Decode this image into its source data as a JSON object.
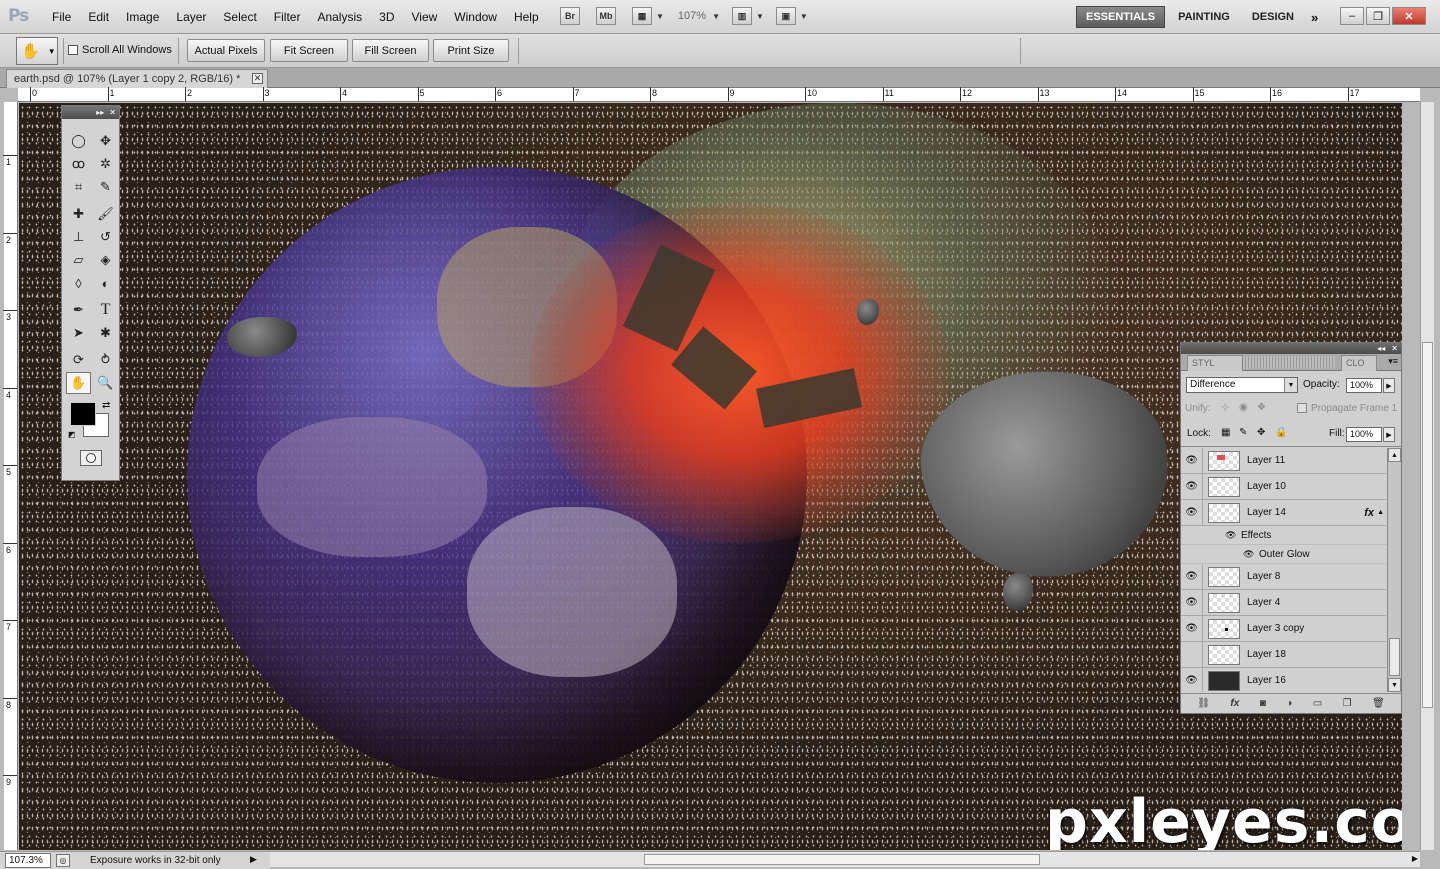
{
  "app": {
    "logo": "Ps"
  },
  "menu": [
    "File",
    "Edit",
    "Image",
    "Layer",
    "Select",
    "Filter",
    "Analysis",
    "3D",
    "View",
    "Window",
    "Help"
  ],
  "appbar": {
    "bridge": "Br",
    "minibridge": "Mb",
    "zoom": "107%"
  },
  "workspaces": {
    "essentials": "ESSENTIALS",
    "painting": "PAINTING",
    "design": "DESIGN",
    "more": "»"
  },
  "options": {
    "scroll_all_label": "Scroll All Windows",
    "actual_pixels": "Actual Pixels",
    "fit_screen": "Fit Screen",
    "fill_screen": "Fill Screen",
    "print_size": "Print Size"
  },
  "document": {
    "tab_title": "earth.psd @ 107% (Layer 1 copy 2, RGB/16) *"
  },
  "ruler": {
    "top": [
      "0",
      "1",
      "2",
      "3",
      "4",
      "5",
      "6",
      "7",
      "8",
      "9",
      "10",
      "11",
      "12",
      "13",
      "14",
      "15",
      "16",
      "17"
    ],
    "left": [
      "1",
      "2",
      "3",
      "4",
      "5",
      "6",
      "7",
      "8",
      "9"
    ]
  },
  "watermark": "pxleyes.com",
  "layers_panel": {
    "tab_styles": "STYL",
    "tab_clone": "CLO",
    "blend_mode": "Difference",
    "opacity_label": "Opacity:",
    "opacity": "100%",
    "unify_label": "Unify:",
    "propagate_label": "Propagate Frame 1",
    "lock_label": "Lock:",
    "fill_label": "Fill:",
    "fill": "100%",
    "layers": [
      {
        "name": "Layer 11",
        "visible": true
      },
      {
        "name": "Layer 10",
        "visible": true
      },
      {
        "name": "Layer 14",
        "visible": true,
        "fx": "fx"
      },
      {
        "name": "Layer 8",
        "visible": true
      },
      {
        "name": "Layer 4",
        "visible": true
      },
      {
        "name": "Layer 3 copy",
        "visible": true
      },
      {
        "name": "Layer 18",
        "visible": false
      },
      {
        "name": "Layer 16",
        "visible": true
      }
    ],
    "effects_label": "Effects",
    "outer_glow_label": "Outer Glow"
  },
  "status": {
    "zoom": "107.3%",
    "message": "Exposure works in 32-bit only"
  }
}
